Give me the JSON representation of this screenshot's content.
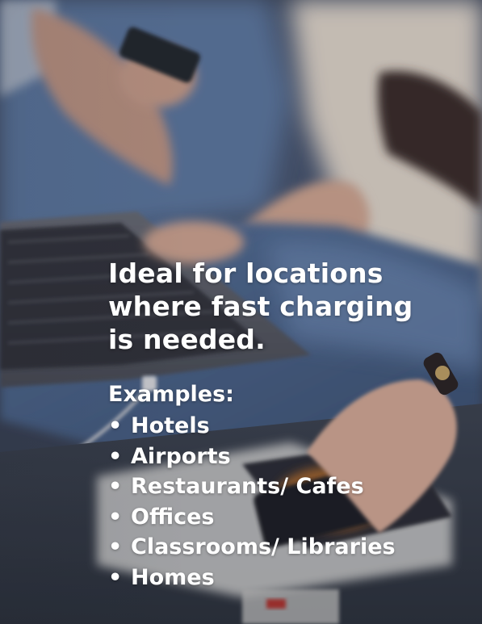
{
  "headline": {
    "line1": "Ideal for locations",
    "line2": "where fast charging",
    "line3": "is needed."
  },
  "examples": {
    "title": "Examples:",
    "bullet": "•",
    "items": [
      "Hotels",
      "Airports",
      "Restaurants/ Cafes",
      "Offices",
      "Classrooms/ Libraries",
      "Homes"
    ]
  },
  "colors": {
    "text": "#ffffff",
    "denim": "#4a6386",
    "sweater": "#e7ddd0",
    "laptop": "#5e6068",
    "background": "#3a4254"
  }
}
